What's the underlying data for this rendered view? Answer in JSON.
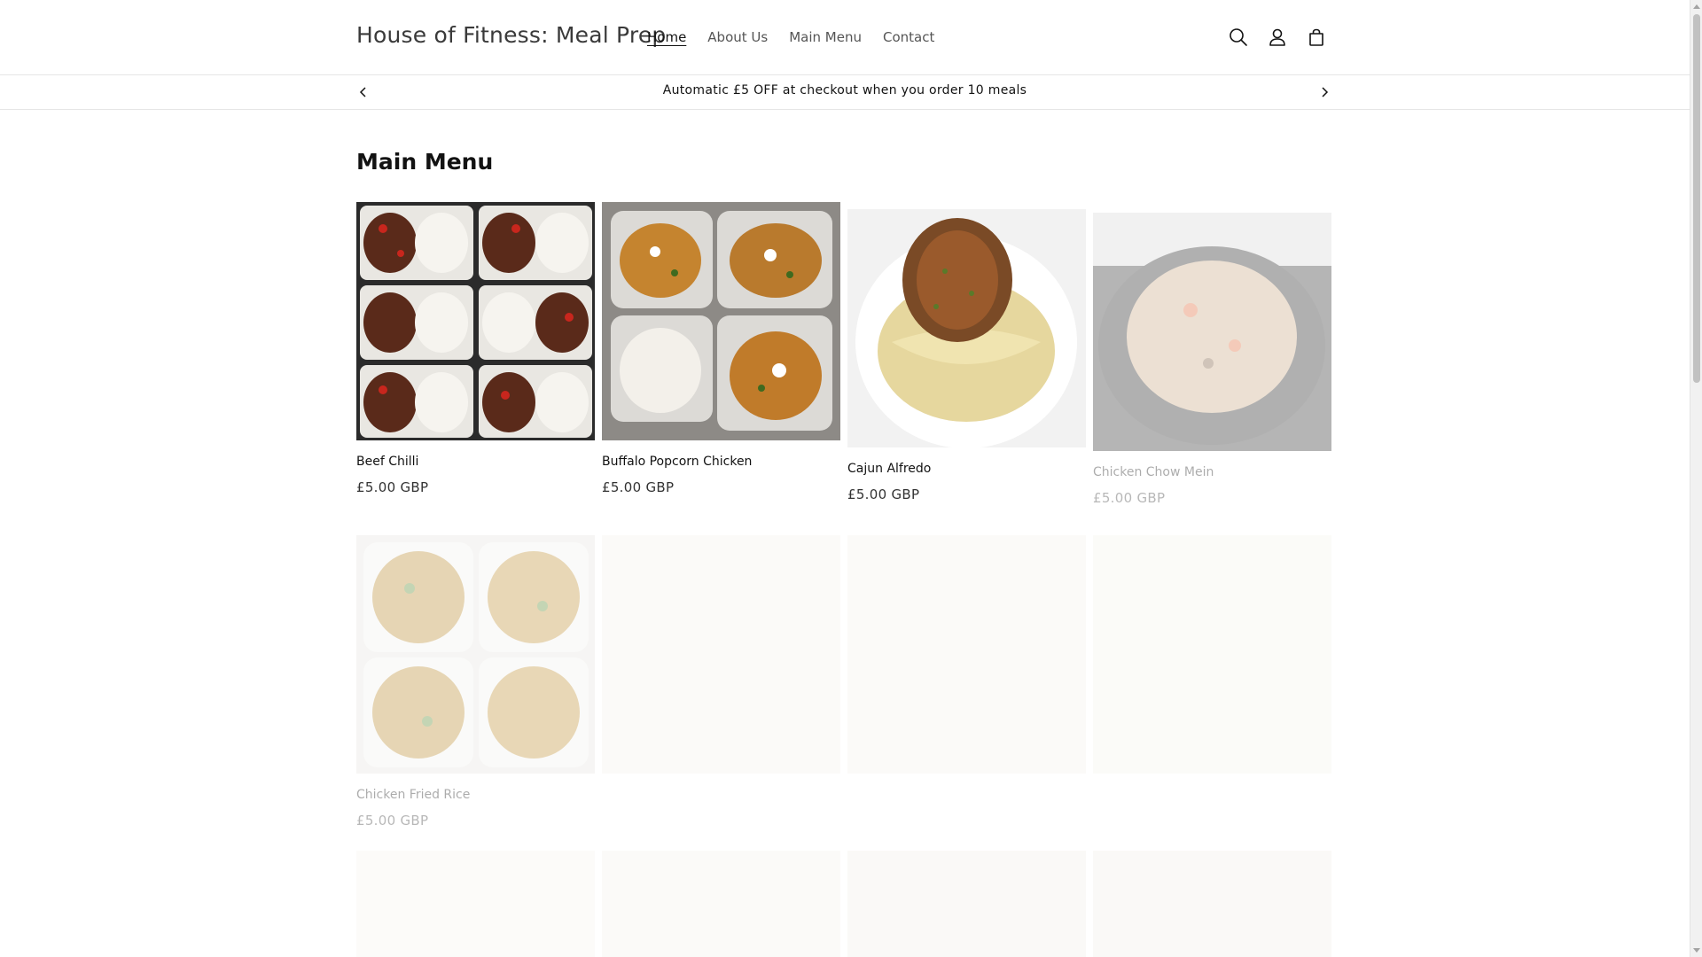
{
  "header": {
    "site_title": "House of Fitness: Meal Prep",
    "nav": [
      {
        "label": "Home",
        "active": true
      },
      {
        "label": "About Us",
        "active": false
      },
      {
        "label": "Main Menu",
        "active": false
      },
      {
        "label": "Contact",
        "active": false
      }
    ],
    "icons": [
      "search-icon",
      "account-icon",
      "cart-icon"
    ]
  },
  "announcement": {
    "text": "Automatic £5 OFF at checkout when you order 10 meals",
    "prev_icon": "chevron-left-icon",
    "next_icon": "chevron-right-icon"
  },
  "main": {
    "section_title": "Main Menu",
    "products": [
      {
        "title": "Beef Chilli",
        "price": "£5.00 GBP"
      },
      {
        "title": "Buffalo Popcorn Chicken",
        "price": "£5.00 GBP"
      },
      {
        "title": "Cajun Alfredo",
        "price": "£5.00 GBP"
      },
      {
        "title": "Chicken Chow Mein",
        "price": "£5.00 GBP"
      },
      {
        "title": "Chicken Fried Rice",
        "price": "£5.00 GBP"
      }
    ]
  },
  "colors": {
    "text": "#121212",
    "muted": "#555555",
    "border": "#e6e6e6",
    "background": "#ffffff"
  }
}
